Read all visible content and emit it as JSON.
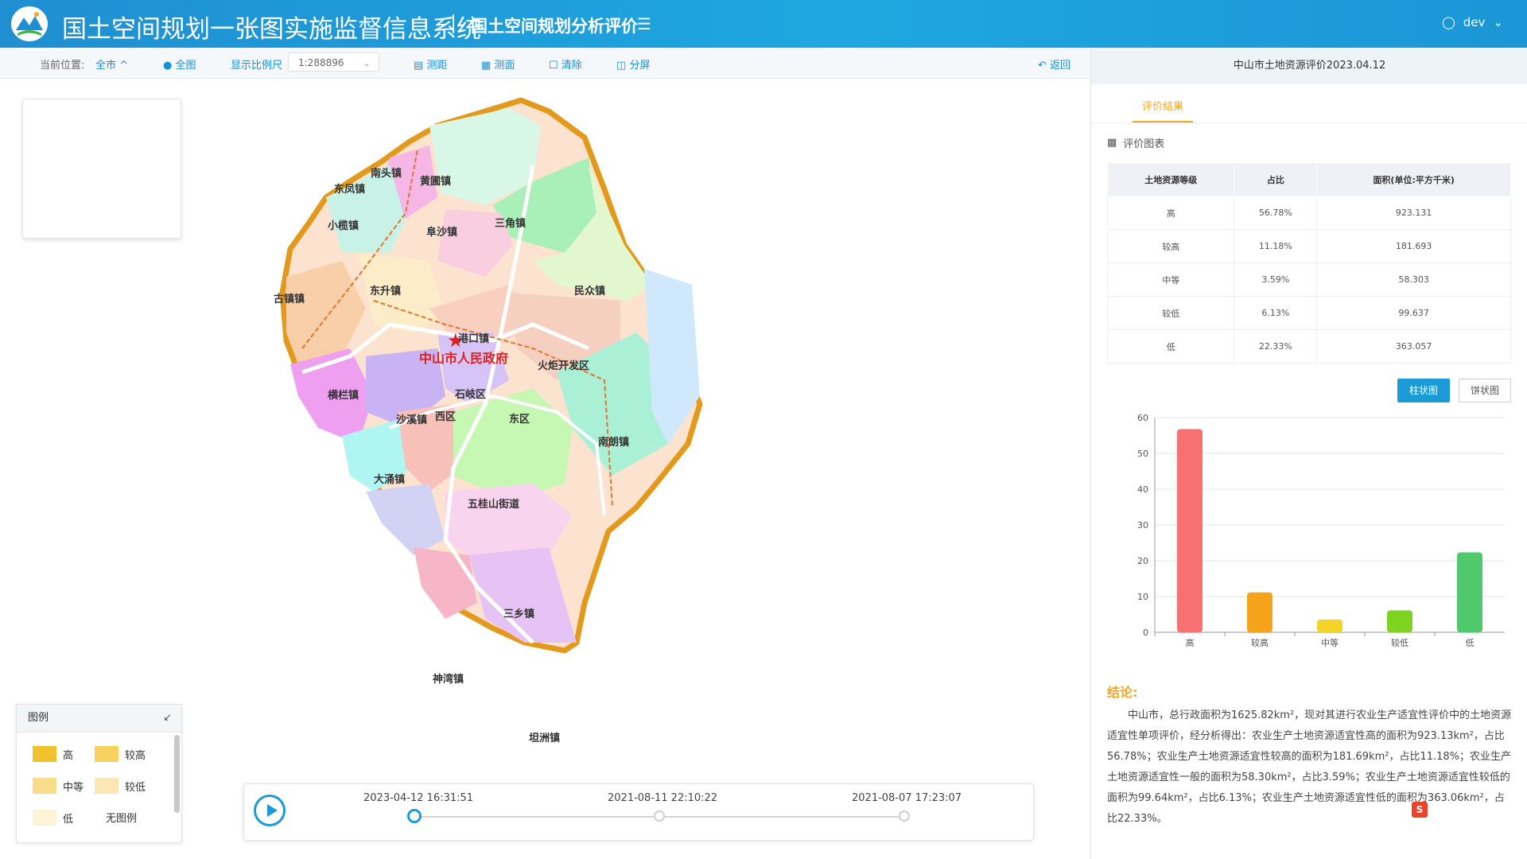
{
  "header": {
    "app_title": "国土空间规划一张图实施监督信息系统",
    "module_title": "国土空间规划分析评价",
    "user": "dev"
  },
  "toolbar": {
    "location_label": "当前位置:",
    "location_value": "全市",
    "full_view": "全图",
    "scale_label": "显示比例尺",
    "scale_value": "1:288896",
    "measure_distance": "测距",
    "measure_area": "测面",
    "clear": "清除",
    "split_screen": "分屏",
    "back": "返回"
  },
  "map": {
    "government_label": "中山市人民政府",
    "towns": [
      "南头镇",
      "黄圃镇",
      "东凤镇",
      "小榄镇",
      "阜沙镇",
      "三角镇",
      "东升镇",
      "古镇镇",
      "民众镇",
      "港口镇",
      "火炬开发区",
      "横栏镇",
      "石岐区",
      "沙溪镇",
      "西区",
      "东区",
      "南朗镇",
      "大涌镇",
      "五桂山街道",
      "三乡镇",
      "神湾镇",
      "坦洲镇"
    ]
  },
  "legend": {
    "title": "图例",
    "items": [
      {
        "label": "高",
        "color": "#f2c12e"
      },
      {
        "label": "较高",
        "color": "#f7d25e"
      },
      {
        "label": "中等",
        "color": "#f9dc8a"
      },
      {
        "label": "较低",
        "color": "#fbe6b4"
      },
      {
        "label": "低",
        "color": "#fdf3d6"
      },
      {
        "label": "无图例",
        "color": "#ffffff"
      }
    ]
  },
  "timeline": {
    "points": [
      "2023-04-12 16:31:51",
      "2021-08-11 22:10:22",
      "2021-08-07 17:23:07"
    ],
    "active_index": 0
  },
  "panel": {
    "title": "中山市土地资源评价2023.04.12",
    "tab": "评价结果",
    "section": "评价图表",
    "table": {
      "headers": [
        "土地资源等级",
        "占比",
        "面积(单位:平方千米)"
      ],
      "rows": [
        [
          "高",
          "56.78%",
          "923.131"
        ],
        [
          "较高",
          "11.18%",
          "181.693"
        ],
        [
          "中等",
          "3.59%",
          "58.303"
        ],
        [
          "较低",
          "6.13%",
          "99.637"
        ],
        [
          "低",
          "22.33%",
          "363.057"
        ]
      ]
    },
    "chart_buttons": {
      "bar": "柱状图",
      "pie": "饼状图"
    },
    "conclusion_title": "结论:",
    "conclusion_text": "中山市，总行政面积为1625.82km²，现对其进行农业生产适宜性评价中的土地资源适宜性单项评价，经分析得出：农业生产土地资源适宜性高的面积为923.13km²，占比56.78%；农业生产土地资源适宜性较高的面积为181.69km²，占比11.18%；农业生产土地资源适宜性一般的面积为58.30km²，占比3.59%；农业生产土地资源适宜性较低的面积为99.64km²，占比6.13%；农业生产土地资源适宜性低的面积为363.06km²，占比22.33%。"
  },
  "chart_data": {
    "type": "bar",
    "categories": [
      "高",
      "较高",
      "中等",
      "较低",
      "低"
    ],
    "values": [
      56.78,
      11.18,
      3.59,
      6.13,
      22.33
    ],
    "colors": [
      "#f87171",
      "#f7a21b",
      "#f5d327",
      "#7ed321",
      "#4fc96b"
    ],
    "ylim": [
      0,
      60
    ],
    "yticks": [
      0,
      10,
      20,
      30,
      40,
      50,
      60
    ],
    "grid": true
  }
}
